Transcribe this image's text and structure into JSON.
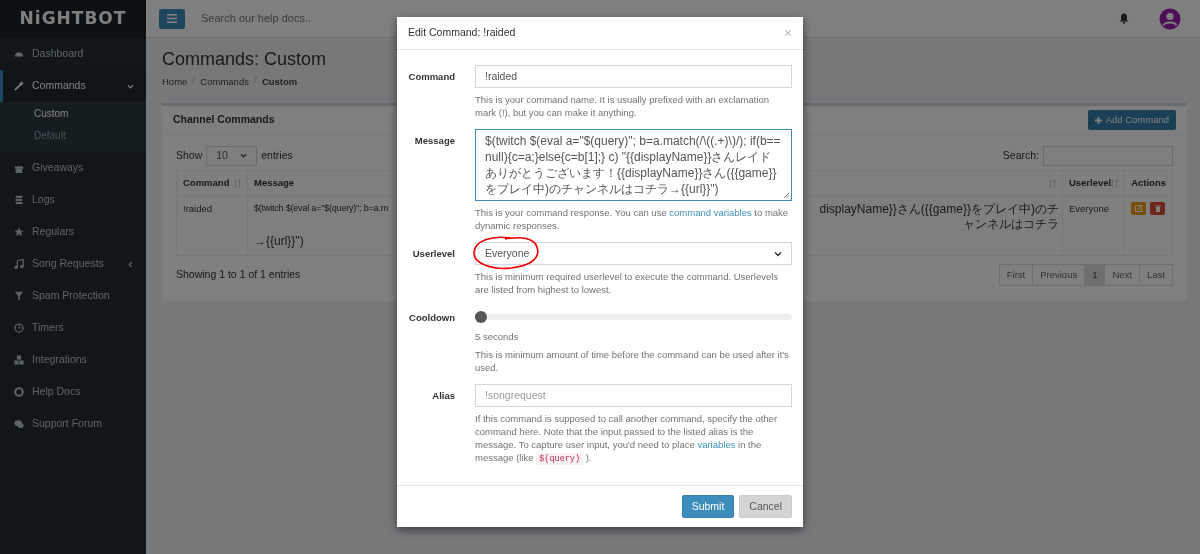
{
  "brand": "NiGHTBOT",
  "topbar": {
    "search_placeholder": "Search our help docs.."
  },
  "sidebar": {
    "items": [
      {
        "kind": "link",
        "label": "Dashboard",
        "selected": false
      },
      {
        "kind": "group",
        "label": "Commands",
        "selected": true,
        "expanded": true,
        "children": [
          {
            "label": "Custom",
            "selected": true
          },
          {
            "label": "Default",
            "selected": false
          }
        ]
      },
      {
        "kind": "link",
        "label": "Giveaways",
        "selected": false
      },
      {
        "kind": "link",
        "label": "Logs",
        "selected": false
      },
      {
        "kind": "link",
        "label": "Regulars",
        "selected": false
      },
      {
        "kind": "group",
        "label": "Song Requests",
        "selected": false,
        "expanded": false
      },
      {
        "kind": "link",
        "label": "Spam Protection",
        "selected": false
      },
      {
        "kind": "link",
        "label": "Timers",
        "selected": false
      },
      {
        "kind": "link",
        "label": "Integrations",
        "selected": false
      },
      {
        "kind": "link",
        "label": "Help Docs",
        "selected": false
      },
      {
        "kind": "link",
        "label": "Support Forum",
        "selected": false
      }
    ]
  },
  "page": {
    "title": "Commands: Custom",
    "breadcrumbs": [
      {
        "label": "Home",
        "current": false
      },
      {
        "label": "Commands",
        "current": false
      },
      {
        "label": "Custom",
        "current": true
      }
    ]
  },
  "card": {
    "title": "Channel Commands",
    "add_button": "Add Command",
    "length_prefix": "Show",
    "length_value": "10",
    "length_suffix": "entries",
    "search_label": "Search:",
    "columns": [
      {
        "label": "Command",
        "sortable": true
      },
      {
        "label": "Message",
        "sortable": true
      },
      {
        "label": "Userlevel",
        "sortable": true
      },
      {
        "label": "Actions",
        "sortable": false
      }
    ],
    "rows": [
      {
        "command": "!raided",
        "message_start": "$(twitch $(eval a=\"$(query)\"; b=a.m",
        "message_end": "displayName}}さん({{game}}をプレイ中)のチャンネルはコチラ",
        "message_line_2": "→{{url}}\")",
        "userlevel": "Everyone"
      }
    ],
    "info": "Showing 1 to 1 of 1 entries",
    "pagination": [
      {
        "label": "First",
        "selected": false
      },
      {
        "label": "Previous",
        "selected": false
      },
      {
        "label": "1",
        "selected": true
      },
      {
        "label": "Next",
        "selected": false
      },
      {
        "label": "Last",
        "selected": false
      }
    ]
  },
  "dialog": {
    "title": "Edit Command: !raided",
    "close": "×",
    "fields": [
      {
        "kind": "text",
        "label": "Command",
        "value": "!raided",
        "help": [
          {
            "kind": "text",
            "text": "This is your command name. It is usually prefixed with an exclamation mark (!), but you can make it anything."
          }
        ]
      },
      {
        "kind": "textarea",
        "label": "Message",
        "value": "$(twitch $(eval a=\"$(query)\"; b=a.match(/\\((.+)\\)/); if(b==null){c=a;}else{c=b[1];} c) \"{{displayName}}さんレイドありがとうございます！{{displayName}}さん({{game}}をプレイ中)のチャンネルはコチラ→{{url}}\")",
        "help": [
          {
            "kind": "text",
            "text": "This is your command response. You can use "
          },
          {
            "kind": "link",
            "text": "command variables"
          },
          {
            "kind": "text",
            "text": " to make dynamic responses."
          }
        ]
      },
      {
        "kind": "select",
        "label": "Userlevel",
        "value": "Everyone",
        "help": [
          {
            "kind": "text",
            "text": "This is minimum required userlevel to execute the command. Userlevels are listed from highest to lowest."
          }
        ]
      },
      {
        "kind": "slider",
        "label": "Cooldown",
        "level": 0.02,
        "reading": "5 seconds",
        "help": [
          {
            "kind": "text",
            "text": "This is minimum amount of time before the command can be used after it's used."
          }
        ]
      },
      {
        "kind": "text",
        "label": "Alias",
        "placeholder": "!songrequest",
        "help": [
          {
            "kind": "text",
            "text": "If this command is supposed to call another command, specify the other command here. Note that the input passed to the listed alias is the message. To capture user input, you'd need to place "
          },
          {
            "kind": "link",
            "text": "variables"
          },
          {
            "kind": "text",
            "text": " in the message (like "
          },
          {
            "kind": "code",
            "text": "$(query)"
          },
          {
            "kind": "text",
            "text": " )."
          }
        ]
      }
    ],
    "buttons": [
      {
        "label": "Submit",
        "kind": "primary",
        "disabled": false
      },
      {
        "label": "Cancel",
        "kind": "secondary",
        "disabled": true
      }
    ]
  }
}
